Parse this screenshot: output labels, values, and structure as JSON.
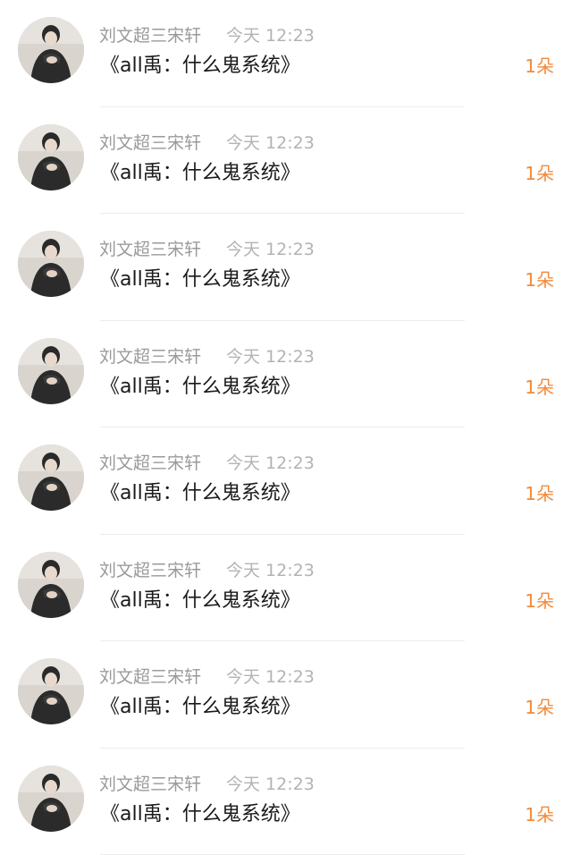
{
  "colors": {
    "name": "#9a9a9a",
    "time": "#b3b3b3",
    "message": "#1a1a1a",
    "gift_count": "#f28a3b",
    "divider": "#ececec"
  },
  "items": [
    {
      "name": "刘文超三宋轩",
      "time": "今天 12:23",
      "message": "《all禹：什么鬼系统》",
      "gift_count": "1朵",
      "avatar_icon": "user-avatar-icon"
    },
    {
      "name": "刘文超三宋轩",
      "time": "今天 12:23",
      "message": "《all禹：什么鬼系统》",
      "gift_count": "1朵",
      "avatar_icon": "user-avatar-icon"
    },
    {
      "name": "刘文超三宋轩",
      "time": "今天 12:23",
      "message": "《all禹：什么鬼系统》",
      "gift_count": "1朵",
      "avatar_icon": "user-avatar-icon"
    },
    {
      "name": "刘文超三宋轩",
      "time": "今天 12:23",
      "message": "《all禹：什么鬼系统》",
      "gift_count": "1朵",
      "avatar_icon": "user-avatar-icon"
    },
    {
      "name": "刘文超三宋轩",
      "time": "今天 12:23",
      "message": "《all禹：什么鬼系统》",
      "gift_count": "1朵",
      "avatar_icon": "user-avatar-icon"
    },
    {
      "name": "刘文超三宋轩",
      "time": "今天 12:23",
      "message": "《all禹：什么鬼系统》",
      "gift_count": "1朵",
      "avatar_icon": "user-avatar-icon"
    },
    {
      "name": "刘文超三宋轩",
      "time": "今天 12:23",
      "message": "《all禹：什么鬼系统》",
      "gift_count": "1朵",
      "avatar_icon": "user-avatar-icon"
    },
    {
      "name": "刘文超三宋轩",
      "time": "今天 12:23",
      "message": "《all禹：什么鬼系统》",
      "gift_count": "1朵",
      "avatar_icon": "user-avatar-icon"
    }
  ]
}
